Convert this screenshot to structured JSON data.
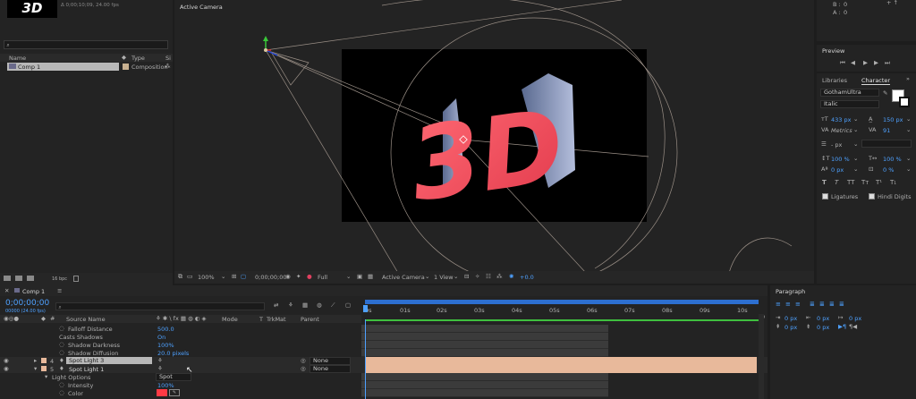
{
  "project": {
    "thumb_text": "3D",
    "comp_info": "Δ 0;00;10;09, 24.00 fps",
    "search_placeholder": "",
    "col_name": "Name",
    "col_type": "Type",
    "col_size": "Si",
    "item_name": "Comp 1",
    "item_type": "Composition",
    "bpc": "16 bpc"
  },
  "info": {
    "b_label": "B :",
    "b_val": "0",
    "a_label": "A :",
    "a_val": "0"
  },
  "viewer": {
    "label": "Active Camera",
    "logo_text": "3D",
    "zoom": "100%",
    "timecode": "0;00;00;00",
    "resolution": "Full",
    "camera": "Active Camera",
    "views": "1 View",
    "exposure": "+0.0"
  },
  "preview": {
    "title": "Preview"
  },
  "character": {
    "tab_libraries": "Libraries",
    "tab_character": "Character",
    "font": "GothamUltra",
    "style": "Italic",
    "font_size": "433 px",
    "leading": "150 px",
    "kerning": "Metrics",
    "tracking": "91",
    "stroke_width": "- px",
    "vscale": "100 %",
    "hscale": "100 %",
    "baseline": "0 px",
    "tsume": "0 %",
    "styles": [
      "T",
      "T",
      "TT",
      "Tт",
      "T¹",
      "T₁"
    ],
    "ligatures": "Ligatures",
    "hindi": "Hindi Digits"
  },
  "paragraph": {
    "title": "Paragraph",
    "indent_left": "0 px",
    "indent_first": "0 px",
    "space_before": "0 px",
    "indent_right": "0 px",
    "space_after": "0 px"
  },
  "timeline": {
    "tab": "Comp 1",
    "timecode": "0;00;00;00",
    "timecode_sub": "00000 (24.00 fps)",
    "col_source": "Source Name",
    "col_mode": "Mode",
    "col_t": "T",
    "col_trkmat": "TrkMat",
    "col_parent": "Parent",
    "ruler": [
      "0s",
      "01s",
      "02s",
      "03s",
      "04s",
      "05s",
      "06s",
      "07s",
      "08s",
      "09s",
      "10s"
    ],
    "rows": [
      {
        "name": "Falloff Distance",
        "value": "500.0"
      },
      {
        "name": "Casts Shadows",
        "value": "On"
      },
      {
        "name": "Shadow Darkness",
        "value": "100%"
      },
      {
        "name": "Shadow Diffusion",
        "value": "20.0 pixels"
      }
    ],
    "layers": [
      {
        "num": "4",
        "name": "Spot Light 3",
        "parent": "None"
      },
      {
        "num": "5",
        "name": "Spot Light 1",
        "parent": "None"
      }
    ],
    "light_options": {
      "label": "Light Options",
      "value": "Spot"
    },
    "intensity": {
      "label": "Intensity",
      "value": "100%"
    },
    "color": {
      "label": "Color"
    }
  },
  "colors": {
    "accent": "#4ea1ff",
    "layer_bar": "#e8b99b",
    "text_red": "#ff4f5e",
    "work_area": "#2d6fd0"
  }
}
